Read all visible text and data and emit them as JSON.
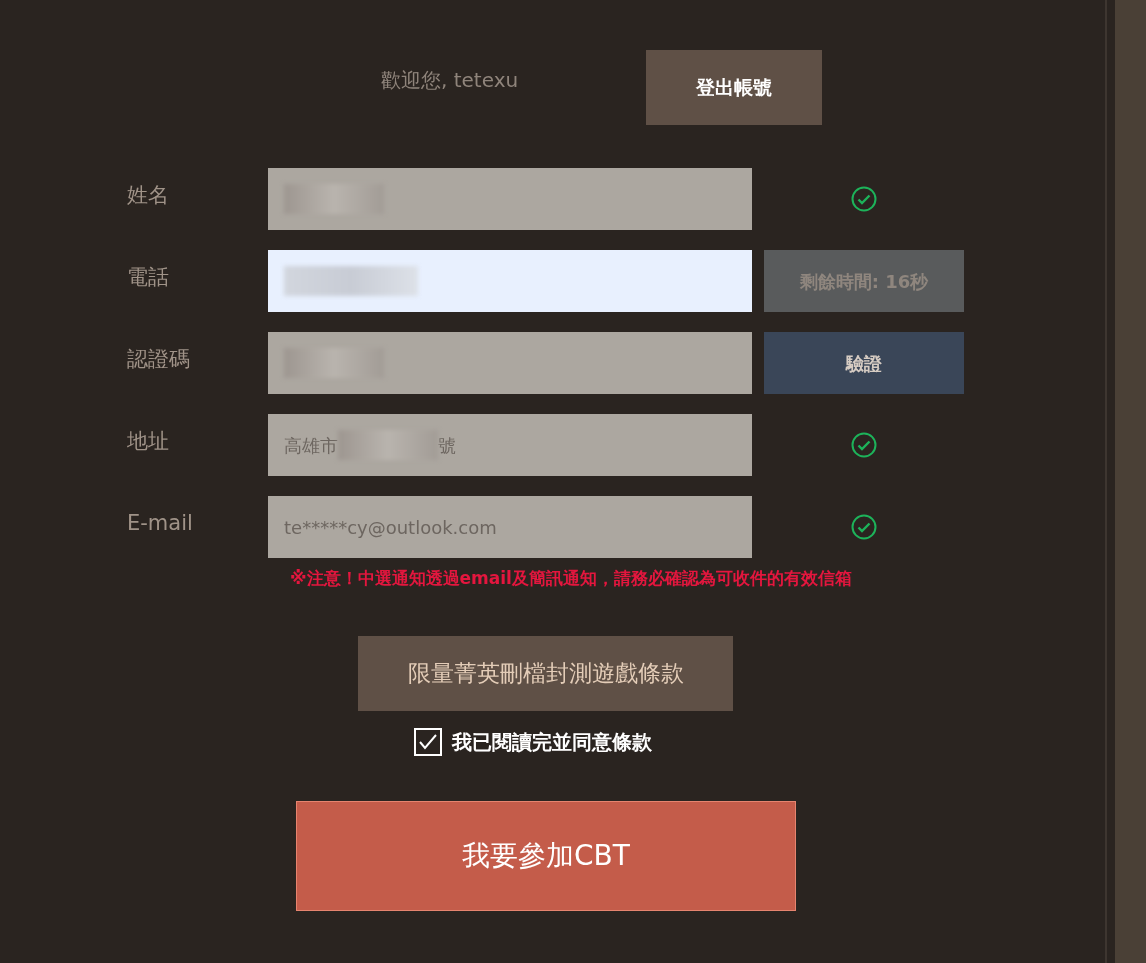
{
  "greeting": "歡迎您, tetexu",
  "logout_button": "登出帳號",
  "fields": [
    {
      "label": "姓名",
      "highlighted": false,
      "value": [
        {
          "kind": "redacted"
        }
      ],
      "trailing": {
        "kind": "check"
      }
    },
    {
      "label": "電話",
      "highlighted": true,
      "value": [
        {
          "kind": "redacted"
        }
      ],
      "trailing": {
        "kind": "timer",
        "text": "剩餘時間: 16秒"
      }
    },
    {
      "label": "認證碼",
      "highlighted": false,
      "value": [
        {
          "kind": "redacted"
        }
      ],
      "trailing": {
        "kind": "button",
        "text": "驗證"
      }
    },
    {
      "label": "地址",
      "highlighted": false,
      "value": [
        {
          "kind": "text",
          "text": "高雄市"
        },
        {
          "kind": "redacted"
        },
        {
          "kind": "text",
          "text": "號"
        }
      ],
      "trailing": {
        "kind": "check"
      }
    },
    {
      "label": "E-mail",
      "highlighted": false,
      "value": [
        {
          "kind": "text",
          "text": "te*****cy@outlook.com"
        }
      ],
      "trailing": {
        "kind": "check"
      }
    }
  ],
  "notice": "※注意！中選通知透過email及簡訊通知，請務必確認為可收件的有效信箱",
  "terms_button": "限量菁英刪檔封測遊戲條款",
  "agree": {
    "label": "我已閱讀完並同意條款",
    "checked": true
  },
  "join_button": "我要參加CBT"
}
